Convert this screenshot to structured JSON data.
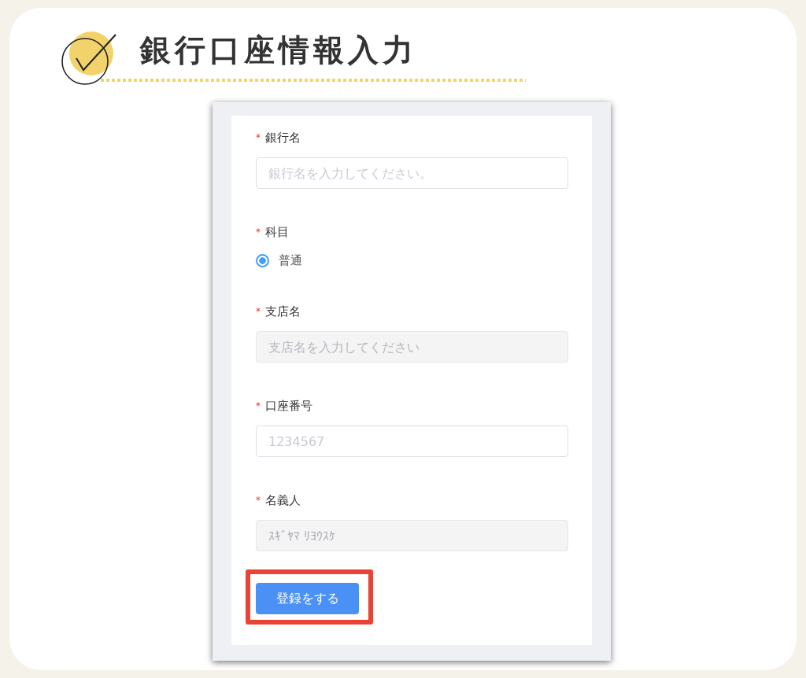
{
  "title": "銀行口座情報入力",
  "form": {
    "fields": [
      {
        "kind": "text",
        "label": "銀行名",
        "required_mark": "*",
        "placeholder": "銀行名を入力してください。",
        "disabled": false
      },
      {
        "kind": "radio",
        "label": "科目",
        "required_mark": "*",
        "options": [
          {
            "label": "普通",
            "selected": true
          }
        ]
      },
      {
        "kind": "text",
        "label": "支店名",
        "required_mark": "*",
        "placeholder": "支店名を入力してください",
        "disabled": true
      },
      {
        "kind": "text",
        "label": "口座番号",
        "required_mark": "*",
        "placeholder": "1234567",
        "disabled": false
      },
      {
        "kind": "text",
        "label": "名義人",
        "required_mark": "*",
        "value": "ｽｷﾞﾔﾏ ﾘﾖｳｽｹ",
        "disabled": true
      }
    ],
    "submit": {
      "label": "登録をする",
      "highlighted": true
    }
  }
}
